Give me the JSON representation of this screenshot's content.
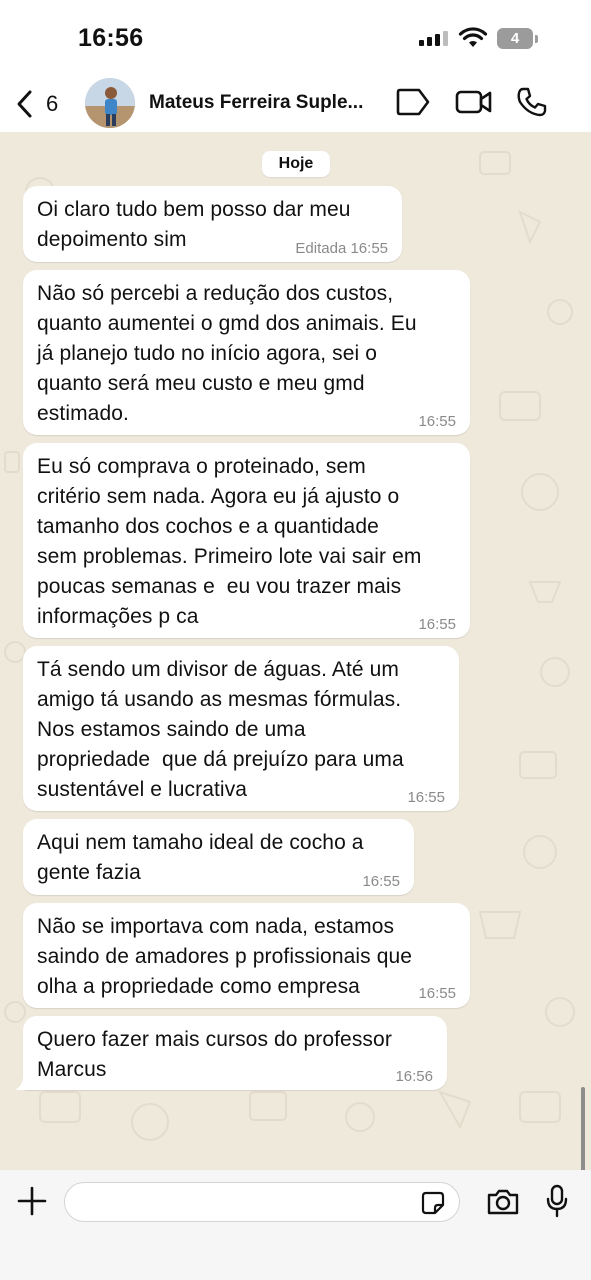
{
  "status": {
    "time": "16:56",
    "battery": "4"
  },
  "header": {
    "back_count": "6",
    "contact_name": "Mateus Ferreira Suple..."
  },
  "chat": {
    "day_label": "Hoje",
    "messages": [
      {
        "text": "Oi claro tudo bem posso dar meu\ndepoimento sim",
        "time": "Editada 16:55"
      },
      {
        "text": "Não só percebi a redução dos custos,\nquanto aumentei o gmd dos animais. Eu\njá planejo tudo no início agora, sei o\nquanto será meu custo e meu gmd\nestimado.",
        "time": "16:55"
      },
      {
        "text": "Eu só comprava o proteinado, sem\ncritério sem nada. Agora eu já ajusto o\ntamanho dos cochos e a quantidade\nsem problemas. Primeiro lote vai sair em\npoucas semanas e  eu vou trazer mais\ninformações p ca",
        "time": "16:55"
      },
      {
        "text": "Tá sendo um divisor de águas. Até um\namigo tá usando as mesmas fórmulas.\nNos estamos saindo de uma\npropriedade  que dá prejuízo para uma\nsustentável e lucrativa",
        "time": "16:55"
      },
      {
        "text": "Aqui nem tamaho ideal de cocho a\ngente fazia",
        "time": "16:55"
      },
      {
        "text": "Não se importava com nada, estamos\nsaindo de amadores p profissionais que\nolha a propriedade como empresa",
        "time": "16:55"
      },
      {
        "text": "Quero fazer mais cursos do professor\nMarcus",
        "time": "16:56"
      }
    ]
  },
  "input": {
    "placeholder": ""
  },
  "icons": {
    "back": "chevron-left-icon",
    "label": "label-icon",
    "video": "video-call-icon",
    "phone": "phone-icon",
    "plus": "plus-icon",
    "sticker": "sticker-icon",
    "camera": "camera-icon",
    "mic": "microphone-icon"
  }
}
